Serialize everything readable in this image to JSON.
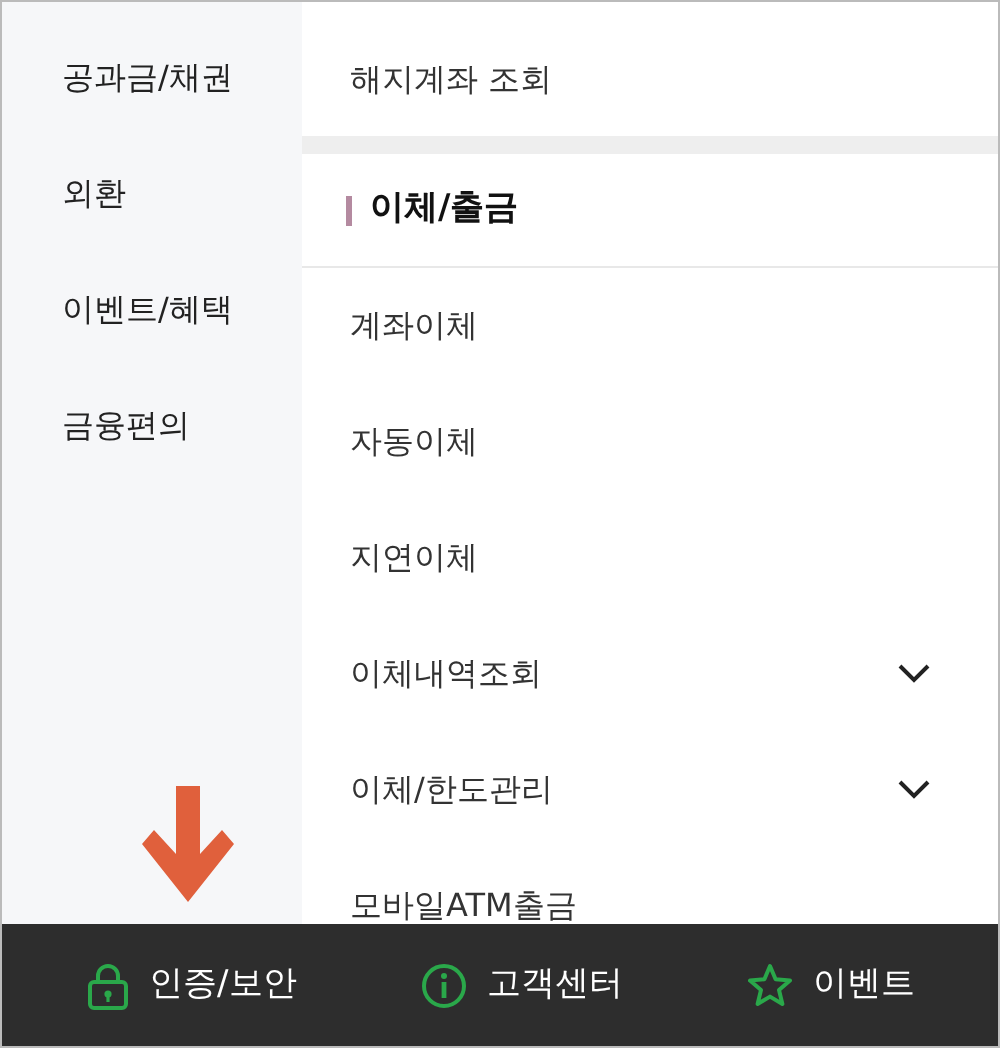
{
  "sidebar": {
    "items": [
      {
        "label": "공과금/채권"
      },
      {
        "label": "외환"
      },
      {
        "label": "이벤트/혜택"
      },
      {
        "label": "금융편의"
      }
    ]
  },
  "submenu": {
    "top_item": "해지계좌 조회",
    "section_title": "이체/출금",
    "items": [
      {
        "label": "계좌이체",
        "kind": "link"
      },
      {
        "label": "자동이체",
        "kind": "link"
      },
      {
        "label": "지연이체",
        "kind": "link"
      },
      {
        "label": "이체내역조회",
        "kind": "expandable",
        "expanded": false
      },
      {
        "label": "이체/한도관리",
        "kind": "expandable",
        "expanded": false
      },
      {
        "label": "모바일ATM출금",
        "kind": "link"
      }
    ]
  },
  "bottom_bar": [
    {
      "label": "인증/보안",
      "kind": "lock"
    },
    {
      "label": "고객센터",
      "kind": "info"
    },
    {
      "label": "이벤트",
      "kind": "star"
    }
  ]
}
